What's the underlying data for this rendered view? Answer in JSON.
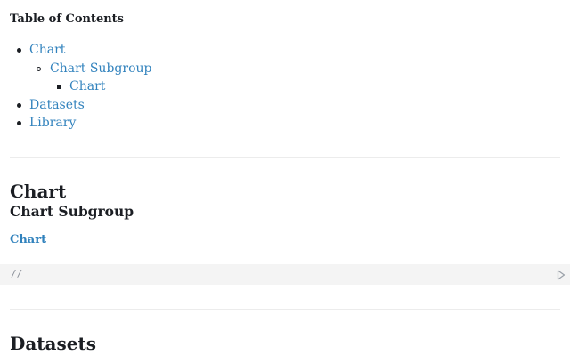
{
  "toc": {
    "title": "Table of Contents",
    "items": [
      {
        "label": "Chart"
      },
      {
        "label": "Chart Subgroup"
      },
      {
        "label": "Chart"
      },
      {
        "label": "Datasets"
      },
      {
        "label": "Library"
      }
    ]
  },
  "sections": {
    "chart": {
      "heading": "Chart",
      "subheading": "Chart Subgroup",
      "link_label": "Chart"
    },
    "datasets": {
      "heading": "Datasets"
    }
  },
  "code_cell": {
    "code": "//",
    "run_icon": "play-icon"
  },
  "colors": {
    "link": "#3182bd",
    "text": "#1b1e23",
    "cell_background": "#f4f4f4",
    "divider": "#ececec"
  }
}
